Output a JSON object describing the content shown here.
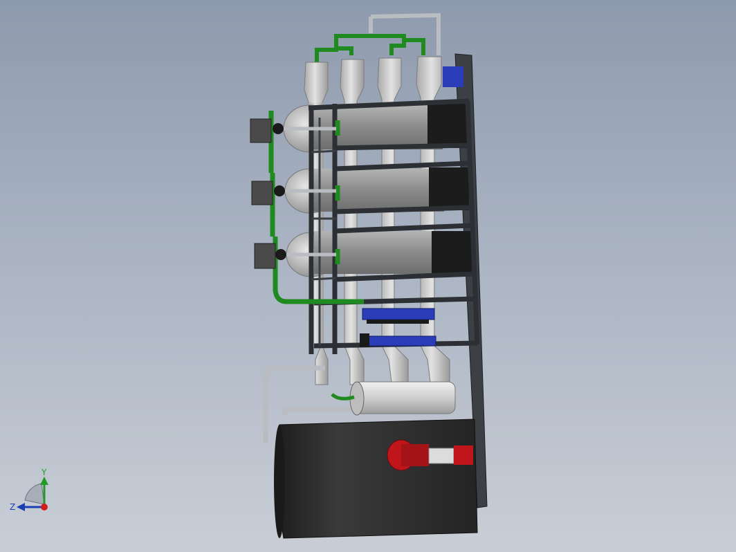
{
  "viewport": {
    "background_top": "#8e9aad",
    "background_bottom": "#c9ced6"
  },
  "model": {
    "frame_color": "#2c2f33",
    "vessel_color": "#8f8f8f",
    "vessel_shadow": "#1c1c1c",
    "membrane_color": "#c9c9c9",
    "pipe_green": "#1f8a1f",
    "pipe_grey": "#b9bcc0",
    "pump_blue": "#2a3cb8",
    "motor_red": "#c0161b",
    "tank_color": "#2e2e2e",
    "cartridge_filter_color": "#d6d6d6"
  },
  "triad": {
    "y_label": "Y",
    "z_label": "Z",
    "y_color": "#1f9a2a",
    "z_color": "#1a3fb0",
    "x_color": "#d11f1f"
  }
}
